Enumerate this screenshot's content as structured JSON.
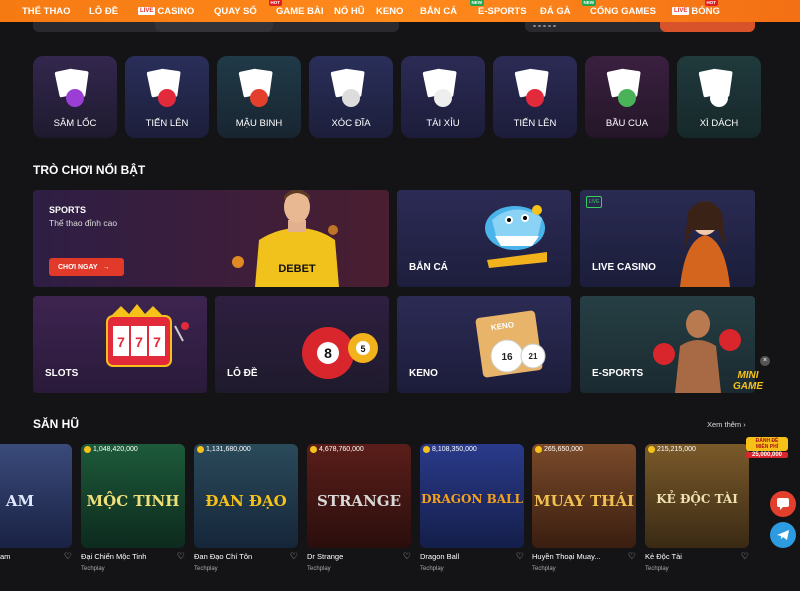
{
  "nav": {
    "items": [
      {
        "label": "THỂ THAO",
        "live": false,
        "badge": ""
      },
      {
        "label": "LÔ ĐỀ",
        "live": false,
        "badge": ""
      },
      {
        "label": "CASINO",
        "live": true,
        "badge": ""
      },
      {
        "label": "QUAY SỐ",
        "live": false,
        "badge": "HOT"
      },
      {
        "label": "GAME BÀI",
        "live": false,
        "badge": ""
      },
      {
        "label": "NỔ HŨ",
        "live": false,
        "badge": ""
      },
      {
        "label": "KENO",
        "live": false,
        "badge": ""
      },
      {
        "label": "BẮN CÁ",
        "live": false,
        "badge": "NEW"
      },
      {
        "label": "E-SPORTS",
        "live": false,
        "badge": ""
      },
      {
        "label": "ĐÁ GÀ",
        "live": false,
        "badge": "NEW"
      },
      {
        "label": "CỔNG GAMES",
        "live": false,
        "badge": ""
      },
      {
        "label": "BÓNG",
        "live": true,
        "badge": "HOT"
      }
    ],
    "live_tag": "LIVE"
  },
  "categories": [
    {
      "label": "SÂM LỐC",
      "icon": "sam-loc-icon"
    },
    {
      "label": "TIẾN LÊN",
      "icon": "tien-len-icon"
    },
    {
      "label": "MẬU BINH",
      "icon": "mau-binh-icon"
    },
    {
      "label": "XÓC ĐĨA",
      "icon": "xoc-dia-icon"
    },
    {
      "label": "TÀI XỈU",
      "icon": "tai-xiu-icon"
    },
    {
      "label": "TIẾN LÊN",
      "icon": "tien-len-chips-icon"
    },
    {
      "label": "BẦU CUA",
      "icon": "bau-cua-icon"
    },
    {
      "label": "XÌ DÁCH",
      "icon": "xi-dach-icon"
    }
  ],
  "featured": {
    "title": "TRÒ CHƠI NỔI BẬT",
    "sports": {
      "title": "SPORTS",
      "subtitle": "Thể thao đỉnh cao",
      "button": "CHƠI NGAY",
      "jersey": "DEBET"
    },
    "tiles": {
      "ban_ca": "BẮN CÁ",
      "live_casino": "LIVE CASINO",
      "slots": "SLOTS",
      "lo_de": "LÔ ĐỀ",
      "keno": "KENO",
      "esports": "E-SPORTS"
    },
    "keno_card_text": "KENO",
    "keno_balls": [
      "16",
      "21"
    ],
    "lode_balls": [
      "8",
      "5"
    ]
  },
  "jackpot": {
    "title": "SĂN HŨ",
    "view_more": "Xem thêm",
    "games": [
      {
        "name": "am",
        "jackpot": "",
        "provider": "",
        "art": "AM"
      },
      {
        "name": "Đại Chiến Mộc Tinh",
        "jackpot": "1,048,420,000",
        "provider": "Techplay",
        "art": "MỘC TINH"
      },
      {
        "name": "Đan Đạo Chí Tôn",
        "jackpot": "1,131,680,000",
        "provider": "Techplay",
        "art": "ĐAN ĐẠO"
      },
      {
        "name": "Dr Strange",
        "jackpot": "4,678,760,000",
        "provider": "Techplay",
        "art": "STRANGE"
      },
      {
        "name": "Dragon Ball",
        "jackpot": "8,108,350,000",
        "provider": "Techplay",
        "art": "DRAGON BALL"
      },
      {
        "name": "Huyền Thoại Muay...",
        "jackpot": "265,650,000",
        "provider": "Techplay",
        "art": "MUAY THÁI"
      },
      {
        "name": "Kẻ Độc Tài",
        "jackpot": "215,215,000",
        "provider": "Techplay",
        "art": "KẺ ĐỘC TÀI"
      }
    ]
  },
  "floating": {
    "mini_game": "MINI GAME",
    "promo_line1": "ĐÁNH ĐỀ",
    "promo_line2": "MIỄN PHÍ",
    "promo_amount": "25,000,000",
    "live_badge": "LIVE"
  },
  "colors": {
    "nav": "#f57a12",
    "accent_red": "#e23a2a",
    "bg": "#141416"
  }
}
